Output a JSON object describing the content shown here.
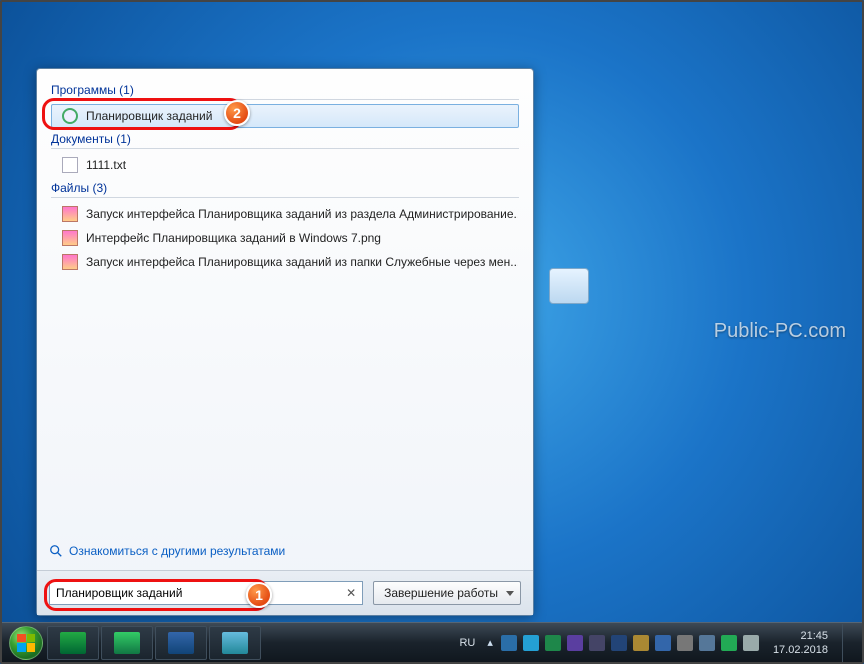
{
  "watermark": "Public-PC.com",
  "start_menu": {
    "sections": {
      "programs": {
        "title": "Программы (1)",
        "items": [
          "Планировщик заданий"
        ]
      },
      "documents": {
        "title": "Документы (1)",
        "items": [
          "1111.txt"
        ]
      },
      "files": {
        "title": "Файлы (3)",
        "items": [
          "Запуск интерфейса Планировщика заданий из раздела Администрирование...",
          "Интерфейс Планировщика заданий в Windows 7.png",
          "Запуск интерфейса Планировщика заданий из папки Служебные через мен..."
        ]
      }
    },
    "see_more": "Ознакомиться с другими результатами",
    "search_value": "Планировщик заданий",
    "shutdown": "Завершение работы"
  },
  "callouts": {
    "badge1": "1",
    "badge2": "2"
  },
  "taskbar": {
    "lang": "RU",
    "time": "21:45",
    "date": "17.02.2018"
  }
}
